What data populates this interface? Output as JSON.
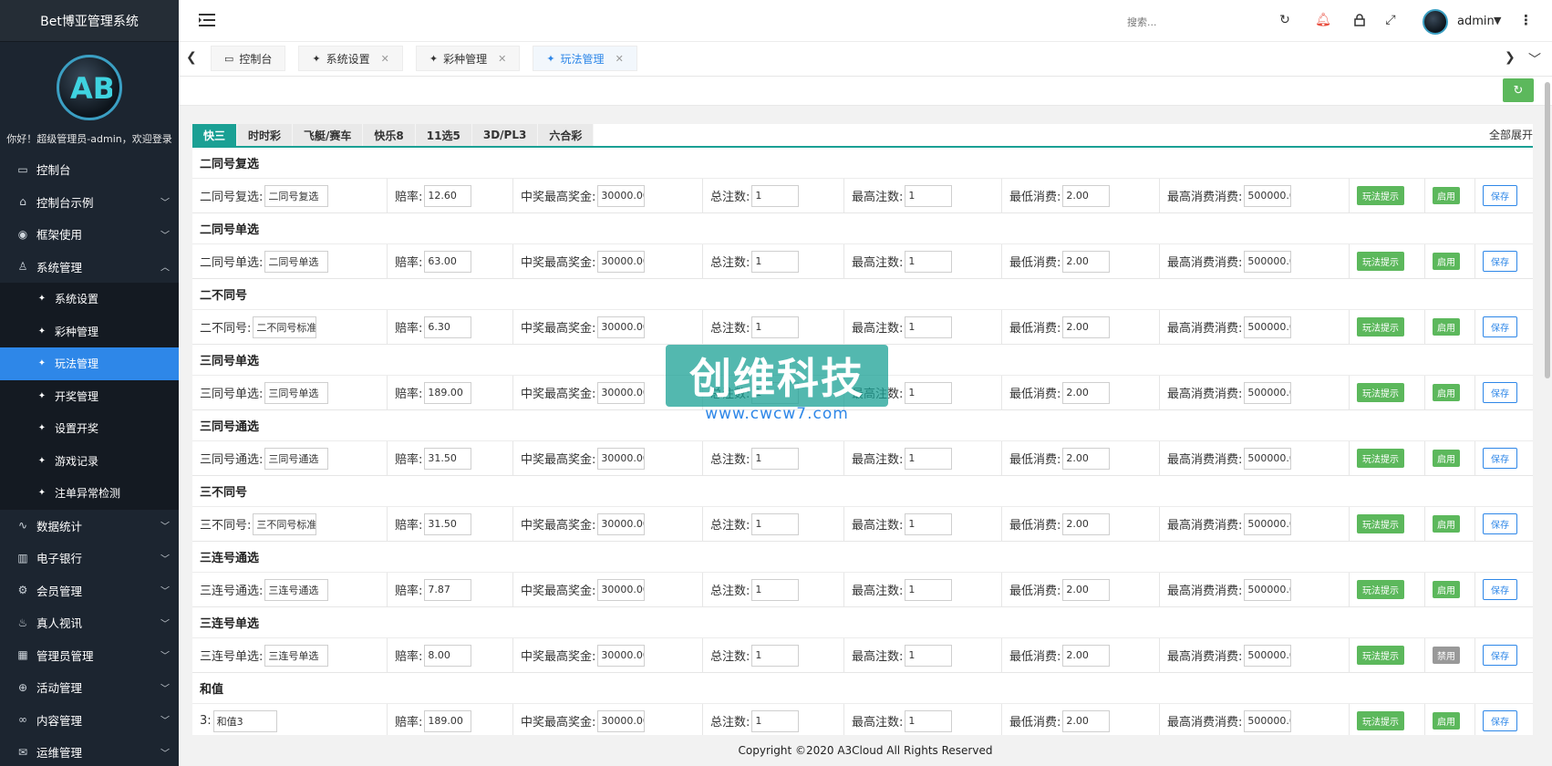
{
  "app": {
    "title": "Bet博亚管理系统"
  },
  "sidebar": {
    "welcome": "你好！超级管理员-admin，欢迎登录",
    "menu": [
      {
        "label": "控制台",
        "icon": "monitor-icon"
      },
      {
        "label": "控制台示例",
        "icon": "home-icon"
      },
      {
        "label": "框架使用",
        "icon": "ok-icon"
      },
      {
        "label": "系统管理",
        "icon": "user-icon"
      }
    ],
    "submenu": [
      {
        "label": "系统设置"
      },
      {
        "label": "彩种管理"
      },
      {
        "label": "玩法管理"
      },
      {
        "label": "开奖管理"
      },
      {
        "label": "设置开奖"
      },
      {
        "label": "游戏记录"
      },
      {
        "label": "注单异常检测"
      }
    ],
    "menu2": [
      {
        "label": "数据统计",
        "icon": "chart-icon"
      },
      {
        "label": "电子银行",
        "icon": "book-icon"
      },
      {
        "label": "会员管理",
        "icon": "gear-icon"
      },
      {
        "label": "真人视讯",
        "icon": "fire-icon"
      },
      {
        "label": "管理员管理",
        "icon": "grid-icon"
      },
      {
        "label": "活动管理",
        "icon": "plus-circle-icon"
      },
      {
        "label": "内容管理",
        "icon": "link-icon"
      },
      {
        "label": "运维管理",
        "icon": "mail-icon"
      }
    ]
  },
  "header": {
    "search_placeholder": "搜索...",
    "user": "admin"
  },
  "tabs": [
    {
      "label": "控制台",
      "closable": false
    },
    {
      "label": "系统设置",
      "closable": true
    },
    {
      "label": "彩种管理",
      "closable": true
    },
    {
      "label": "玩法管理",
      "closable": true,
      "active": true
    }
  ],
  "categories": [
    "快三",
    "时时彩",
    "飞艇/赛车",
    "快乐8",
    "11选5",
    "3D/PL3",
    "六合彩"
  ],
  "expand_all": "全部展开",
  "labels": {
    "odds": "赔率:",
    "max_prize": "中奖最高奖金:",
    "total_bets": "总注数:",
    "max_bets": "最高注数:",
    "min_spend": "最低消费:",
    "max_spend": "最高消费消费:",
    "tip": "玩法提示",
    "enabled": "启用",
    "disabled": "禁用",
    "save": "保存"
  },
  "groups": [
    {
      "title": "二同号复选",
      "name": "二同号复选:",
      "name_value": "二同号复选",
      "odds": "12.60",
      "max_prize": "30000.00",
      "total": "1",
      "max_bets": "1",
      "min": "2.00",
      "max_spend": "500000.0",
      "status": "启用"
    },
    {
      "title": "二同号单选",
      "name": "二同号单选:",
      "name_value": "二同号单选",
      "odds": "63.00",
      "max_prize": "30000.00",
      "total": "1",
      "max_bets": "1",
      "min": "2.00",
      "max_spend": "500000.0",
      "status": "启用"
    },
    {
      "title": "二不同号",
      "name": "二不同号:",
      "name_value": "二不同号标准",
      "odds": "6.30",
      "max_prize": "30000.00",
      "total": "1",
      "max_bets": "1",
      "min": "2.00",
      "max_spend": "500000.0",
      "status": "启用"
    },
    {
      "title": "三同号单选",
      "name": "三同号单选:",
      "name_value": "三同号单选",
      "odds": "189.00",
      "max_prize": "30000.00",
      "total": "1",
      "max_bets": "1",
      "min": "2.00",
      "max_spend": "500000.0",
      "status": "启用"
    },
    {
      "title": "三同号通选",
      "name": "三同号通选:",
      "name_value": "三同号通选",
      "odds": "31.50",
      "max_prize": "30000.00",
      "total": "1",
      "max_bets": "1",
      "min": "2.00",
      "max_spend": "500000.0",
      "status": "启用"
    },
    {
      "title": "三不同号",
      "name": "三不同号:",
      "name_value": "三不同号标准",
      "odds": "31.50",
      "max_prize": "30000.00",
      "total": "1",
      "max_bets": "1",
      "min": "2.00",
      "max_spend": "500000.0",
      "status": "启用"
    },
    {
      "title": "三连号通选",
      "name": "三连号通选:",
      "name_value": "三连号通选",
      "odds": "7.87",
      "max_prize": "30000.00",
      "total": "1",
      "max_bets": "1",
      "min": "2.00",
      "max_spend": "500000.0",
      "status": "启用"
    },
    {
      "title": "三连号单选",
      "name": "三连号单选:",
      "name_value": "三连号单选",
      "odds": "8.00",
      "max_prize": "30000.00",
      "total": "1",
      "max_bets": "1",
      "min": "2.00",
      "max_spend": "500000.0",
      "status": "禁用"
    },
    {
      "title": "和值",
      "name": "3:",
      "name_value": "和值3",
      "odds": "189.00",
      "max_prize": "30000.00",
      "total": "1",
      "max_bets": "1",
      "min": "2.00",
      "max_spend": "500000.0",
      "status": "启用"
    }
  ],
  "watermark": {
    "title": "创维科技",
    "url": "www.cwcw7.com"
  },
  "footer": "Copyright ©2020 A3Cloud All Rights Reserved"
}
